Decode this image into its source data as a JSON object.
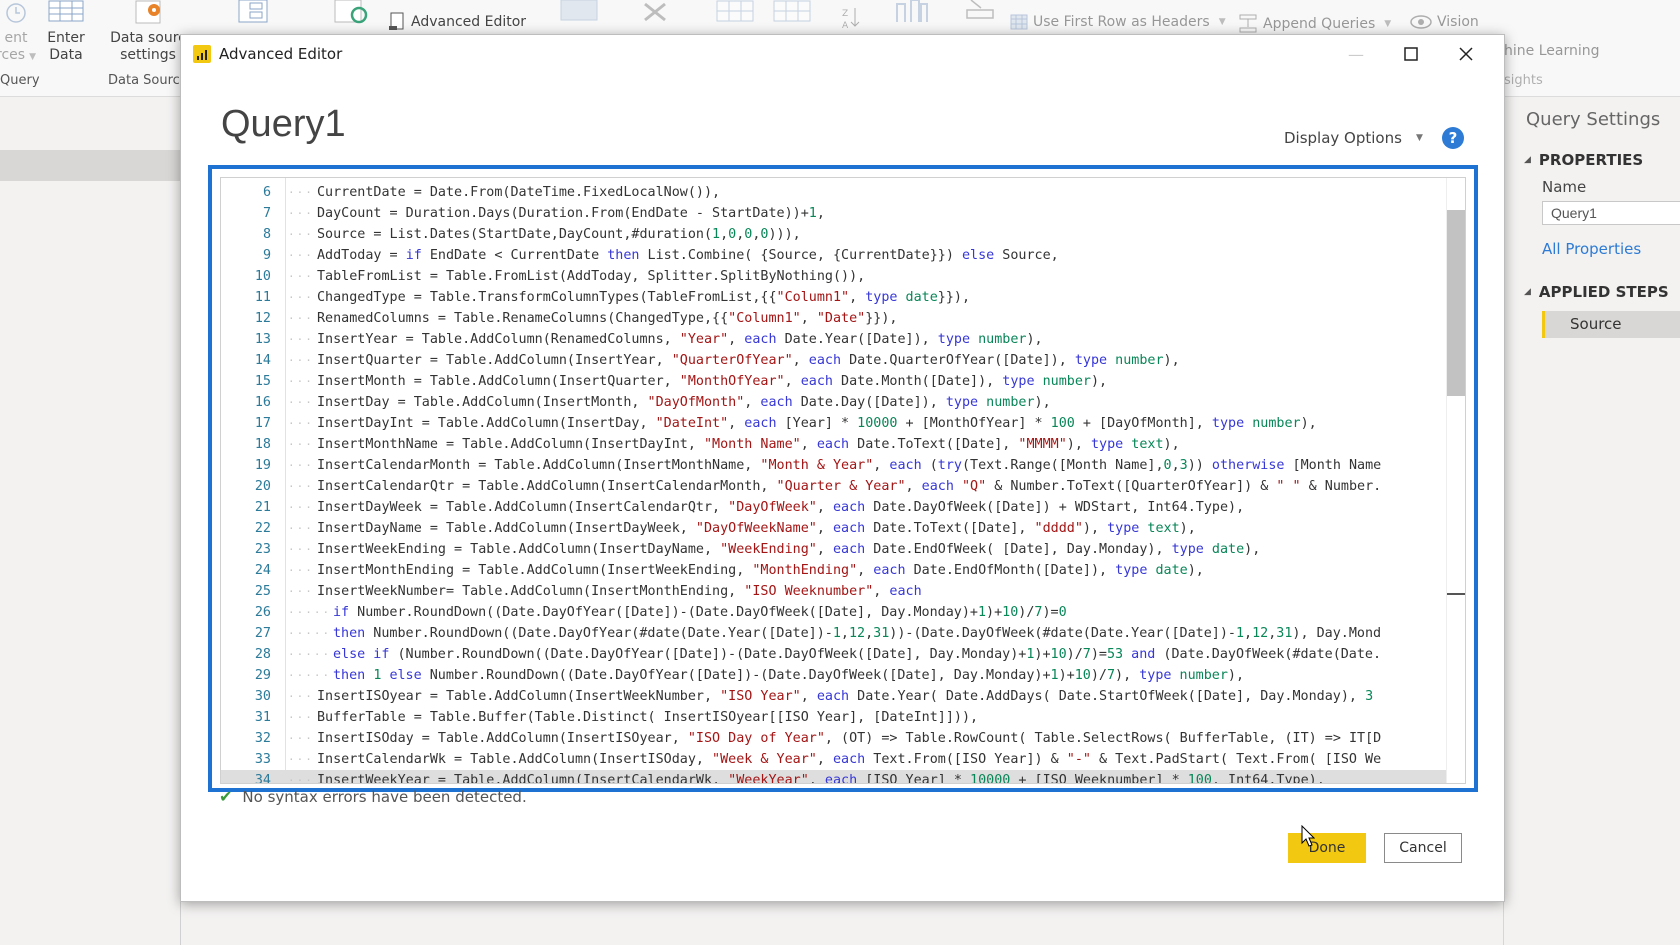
{
  "ribbon": {
    "recent_sources": "Recent Sources",
    "recent_sources_line1": "ent",
    "recent_sources_line2": "rces",
    "enter_data_line1": "Enter",
    "enter_data_line2": "Data",
    "data_source_settings_line1": "Data sourc",
    "data_source_settings_line2": "settings",
    "advanced_editor": "Advanced Editor",
    "use_first_row": "Use First Row as Headers",
    "append_queries": "Append Queries",
    "vision": "Vision",
    "machine_learning": "hine Learning",
    "insights": "sights",
    "group_query": "Query",
    "group_data_sources": "Data Sourc"
  },
  "query_settings": {
    "title": "Query Settings",
    "properties_header": "PROPERTIES",
    "name_label": "Name",
    "name_value": "Query1",
    "all_properties": "All Properties",
    "applied_steps_header": "APPLIED STEPS",
    "steps": [
      "Source"
    ]
  },
  "dialog": {
    "window_title": "Advanced Editor",
    "query_name": "Query1",
    "display_options": "Display Options",
    "help": "?",
    "status_message": "No syntax errors have been detected.",
    "done_label": "Done",
    "cancel_label": "Cancel"
  },
  "code_lines": [
    {
      "n": "6",
      "d": 1,
      "h": [
        [
          "",
          "CurrentDate = Date.From(DateTime.FixedLocalNow()),"
        ]
      ]
    },
    {
      "n": "7",
      "d": 1,
      "h": [
        [
          "",
          "DayCount = Duration.Days(Duration.From(EndDate - StartDate))+"
        ],
        [
          "n",
          "1"
        ],
        [
          "",
          ","
        ]
      ]
    },
    {
      "n": "8",
      "d": 1,
      "h": [
        [
          "",
          "Source = List.Dates(StartDate,DayCount,#duration("
        ],
        [
          "n",
          "1"
        ],
        [
          "",
          ","
        ],
        [
          "n",
          "0"
        ],
        [
          "",
          ","
        ],
        [
          "n",
          "0"
        ],
        [
          "",
          ","
        ],
        [
          "n",
          "0"
        ],
        [
          "",
          "))),"
        ]
      ]
    },
    {
      "n": "9",
      "d": 1,
      "h": [
        [
          "",
          "AddToday = "
        ],
        [
          "k",
          "if"
        ],
        [
          "",
          " EndDate < CurrentDate "
        ],
        [
          "k",
          "then"
        ],
        [
          "",
          " List.Combine( {Source, {CurrentDate}}) "
        ],
        [
          "k",
          "else"
        ],
        [
          "",
          " Source,"
        ]
      ]
    },
    {
      "n": "10",
      "d": 1,
      "h": [
        [
          "",
          "TableFromList = Table.FromList(AddToday, Splitter.SplitByNothing()),"
        ]
      ]
    },
    {
      "n": "11",
      "d": 1,
      "h": [
        [
          "",
          "ChangedType = Table.TransformColumnTypes(TableFromList,{{"
        ],
        [
          "s",
          "\"Column1\""
        ],
        [
          "",
          ", "
        ],
        [
          "k",
          "type"
        ],
        [
          "t",
          " date"
        ],
        [
          "",
          "}}),"
        ]
      ]
    },
    {
      "n": "12",
      "d": 1,
      "h": [
        [
          "",
          "RenamedColumns = Table.RenameColumns(ChangedType,{{"
        ],
        [
          "s",
          "\"Column1\""
        ],
        [
          "",
          ", "
        ],
        [
          "s",
          "\"Date\""
        ],
        [
          "",
          "}}),"
        ]
      ]
    },
    {
      "n": "13",
      "d": 1,
      "h": [
        [
          "",
          "InsertYear = Table.AddColumn(RenamedColumns, "
        ],
        [
          "s",
          "\"Year\""
        ],
        [
          "",
          ", "
        ],
        [
          "k",
          "each"
        ],
        [
          "",
          " Date.Year([Date]), "
        ],
        [
          "k",
          "type"
        ],
        [
          "t",
          " number"
        ],
        [
          "",
          "),"
        ]
      ]
    },
    {
      "n": "14",
      "d": 1,
      "h": [
        [
          "",
          "InsertQuarter = Table.AddColumn(InsertYear, "
        ],
        [
          "s",
          "\"QuarterOfYear\""
        ],
        [
          "",
          ", "
        ],
        [
          "k",
          "each"
        ],
        [
          "",
          " Date.QuarterOfYear([Date]), "
        ],
        [
          "k",
          "type"
        ],
        [
          "t",
          " number"
        ],
        [
          "",
          "),"
        ]
      ]
    },
    {
      "n": "15",
      "d": 1,
      "h": [
        [
          "",
          "InsertMonth = Table.AddColumn(InsertQuarter, "
        ],
        [
          "s",
          "\"MonthOfYear\""
        ],
        [
          "",
          ", "
        ],
        [
          "k",
          "each"
        ],
        [
          "",
          " Date.Month([Date]), "
        ],
        [
          "k",
          "type"
        ],
        [
          "t",
          " number"
        ],
        [
          "",
          "),"
        ]
      ]
    },
    {
      "n": "16",
      "d": 1,
      "h": [
        [
          "",
          "InsertDay = Table.AddColumn(InsertMonth, "
        ],
        [
          "s",
          "\"DayOfMonth\""
        ],
        [
          "",
          ", "
        ],
        [
          "k",
          "each"
        ],
        [
          "",
          " Date.Day([Date]), "
        ],
        [
          "k",
          "type"
        ],
        [
          "t",
          " number"
        ],
        [
          "",
          "),"
        ]
      ]
    },
    {
      "n": "17",
      "d": 1,
      "h": [
        [
          "",
          "InsertDayInt = Table.AddColumn(InsertDay, "
        ],
        [
          "s",
          "\"DateInt\""
        ],
        [
          "",
          ", "
        ],
        [
          "k",
          "each"
        ],
        [
          "",
          " [Year] * "
        ],
        [
          "n",
          "10000"
        ],
        [
          "",
          " + [MonthOfYear] * "
        ],
        [
          "n",
          "100"
        ],
        [
          "",
          " + [DayOfMonth], "
        ],
        [
          "k",
          "type"
        ],
        [
          "t",
          " number"
        ],
        [
          "",
          "),"
        ]
      ]
    },
    {
      "n": "18",
      "d": 1,
      "h": [
        [
          "",
          "InsertMonthName = Table.AddColumn(InsertDayInt, "
        ],
        [
          "s",
          "\"Month Name\""
        ],
        [
          "",
          ", "
        ],
        [
          "k",
          "each"
        ],
        [
          "",
          " Date.ToText([Date], "
        ],
        [
          "s",
          "\"MMMM\""
        ],
        [
          "",
          "), "
        ],
        [
          "k",
          "type"
        ],
        [
          "t",
          " text"
        ],
        [
          "",
          "),"
        ]
      ]
    },
    {
      "n": "19",
      "d": 1,
      "h": [
        [
          "",
          "InsertCalendarMonth = Table.AddColumn(InsertMonthName, "
        ],
        [
          "s",
          "\"Month & Year\""
        ],
        [
          "",
          ", "
        ],
        [
          "k",
          "each"
        ],
        [
          "",
          " ("
        ],
        [
          "k",
          "try"
        ],
        [
          "",
          "(Text.Range([Month Name],"
        ],
        [
          "n",
          "0"
        ],
        [
          "",
          ","
        ],
        [
          "n",
          "3"
        ],
        [
          "",
          ")) "
        ],
        [
          "k",
          "otherwise"
        ],
        [
          "",
          " [Month Name"
        ]
      ]
    },
    {
      "n": "20",
      "d": 1,
      "h": [
        [
          "",
          "InsertCalendarQtr = Table.AddColumn(InsertCalendarMonth, "
        ],
        [
          "s",
          "\"Quarter & Year\""
        ],
        [
          "",
          ", "
        ],
        [
          "k",
          "each"
        ],
        [
          "",
          " "
        ],
        [
          "s",
          "\"Q\""
        ],
        [
          "",
          " & Number.ToText([QuarterOfYear]) & "
        ],
        [
          "s",
          "\" \""
        ],
        [
          "",
          " & Number."
        ]
      ]
    },
    {
      "n": "21",
      "d": 1,
      "h": [
        [
          "",
          "InsertDayWeek = Table.AddColumn(InsertCalendarQtr, "
        ],
        [
          "s",
          "\"DayOfWeek\""
        ],
        [
          "",
          ", "
        ],
        [
          "k",
          "each"
        ],
        [
          "",
          " Date.DayOfWeek([Date]) + WDStart, Int64.Type),"
        ]
      ]
    },
    {
      "n": "22",
      "d": 1,
      "h": [
        [
          "",
          "InsertDayName = Table.AddColumn(InsertDayWeek, "
        ],
        [
          "s",
          "\"DayOfWeekName\""
        ],
        [
          "",
          ", "
        ],
        [
          "k",
          "each"
        ],
        [
          "",
          " Date.ToText([Date], "
        ],
        [
          "s",
          "\"dddd\""
        ],
        [
          "",
          "), "
        ],
        [
          "k",
          "type"
        ],
        [
          "t",
          " text"
        ],
        [
          "",
          "),"
        ]
      ]
    },
    {
      "n": "23",
      "d": 1,
      "h": [
        [
          "",
          "InsertWeekEnding = Table.AddColumn(InsertDayName, "
        ],
        [
          "s",
          "\"WeekEnding\""
        ],
        [
          "",
          ", "
        ],
        [
          "k",
          "each"
        ],
        [
          "",
          " Date.EndOfWeek( [Date], Day.Monday), "
        ],
        [
          "k",
          "type"
        ],
        [
          "t",
          " date"
        ],
        [
          "",
          "),"
        ]
      ]
    },
    {
      "n": "24",
      "d": 1,
      "h": [
        [
          "",
          "InsertMonthEnding = Table.AddColumn(InsertWeekEnding, "
        ],
        [
          "s",
          "\"MonthEnding\""
        ],
        [
          "",
          ", "
        ],
        [
          "k",
          "each"
        ],
        [
          "",
          " Date.EndOfMonth([Date]), "
        ],
        [
          "k",
          "type"
        ],
        [
          "t",
          " date"
        ],
        [
          "",
          "),"
        ]
      ]
    },
    {
      "n": "25",
      "d": 1,
      "h": [
        [
          "",
          "InsertWeekNumber= Table.AddColumn(InsertMonthEnding, "
        ],
        [
          "s",
          "\"ISO Weeknumber\""
        ],
        [
          "",
          ", "
        ],
        [
          "k",
          "each"
        ]
      ]
    },
    {
      "n": "26",
      "d": 2,
      "h": [
        [
          "k",
          "if"
        ],
        [
          "",
          " Number.RoundDown((Date.DayOfYear([Date])-(Date.DayOfWeek([Date], Day.Monday)+"
        ],
        [
          "n",
          "1"
        ],
        [
          "",
          ")+"
        ],
        [
          "n",
          "10"
        ],
        [
          "",
          ")/"
        ],
        [
          "n",
          "7"
        ],
        [
          "",
          ")="
        ],
        [
          "n",
          "0"
        ]
      ]
    },
    {
      "n": "27",
      "d": 2,
      "h": [
        [
          "k",
          "then"
        ],
        [
          "",
          " Number.RoundDown((Date.DayOfYear(#date(Date.Year([Date])-"
        ],
        [
          "n",
          "1"
        ],
        [
          "",
          ","
        ],
        [
          "n",
          "12"
        ],
        [
          "",
          ","
        ],
        [
          "n",
          "31"
        ],
        [
          "",
          "))-(Date.DayOfWeek(#date(Date.Year([Date])-"
        ],
        [
          "n",
          "1"
        ],
        [
          "",
          ","
        ],
        [
          "n",
          "12"
        ],
        [
          "",
          ","
        ],
        [
          "n",
          "31"
        ],
        [
          "",
          "), Day.Mond"
        ]
      ]
    },
    {
      "n": "28",
      "d": 2,
      "h": [
        [
          "k",
          "else if"
        ],
        [
          "",
          " (Number.RoundDown((Date.DayOfYear([Date])-(Date.DayOfWeek([Date], Day.Monday)+"
        ],
        [
          "n",
          "1"
        ],
        [
          "",
          ")+"
        ],
        [
          "n",
          "10"
        ],
        [
          "",
          ")/"
        ],
        [
          "n",
          "7"
        ],
        [
          "",
          ")="
        ],
        [
          "n",
          "53"
        ],
        [
          "",
          " "
        ],
        [
          "k",
          "and"
        ],
        [
          "",
          " (Date.DayOfWeek(#date(Date."
        ]
      ]
    },
    {
      "n": "29",
      "d": 2,
      "h": [
        [
          "k",
          "then"
        ],
        [
          "",
          " "
        ],
        [
          "n",
          "1"
        ],
        [
          "",
          " "
        ],
        [
          "k",
          "else"
        ],
        [
          "",
          " Number.RoundDown((Date.DayOfYear([Date])-(Date.DayOfWeek([Date], Day.Monday)+"
        ],
        [
          "n",
          "1"
        ],
        [
          "",
          ")+"
        ],
        [
          "n",
          "10"
        ],
        [
          "",
          ")/"
        ],
        [
          "n",
          "7"
        ],
        [
          "",
          "), "
        ],
        [
          "k",
          "type"
        ],
        [
          "t",
          " number"
        ],
        [
          "",
          "),"
        ]
      ]
    },
    {
      "n": "30",
      "d": 1,
      "h": [
        [
          "",
          "InsertISOyear = Table.AddColumn(InsertWeekNumber, "
        ],
        [
          "s",
          "\"ISO Year\""
        ],
        [
          "",
          ", "
        ],
        [
          "k",
          "each"
        ],
        [
          "",
          " Date.Year( Date.AddDays( Date.StartOfWeek([Date], Day.Monday), "
        ],
        [
          "n",
          "3"
        ]
      ]
    },
    {
      "n": "31",
      "d": 1,
      "h": [
        [
          "",
          "BufferTable = Table.Buffer(Table.Distinct( InsertISOyear[[ISO Year], [DateInt]])),"
        ]
      ]
    },
    {
      "n": "32",
      "d": 1,
      "h": [
        [
          "",
          "InsertISOday = Table.AddColumn(InsertISOyear, "
        ],
        [
          "s",
          "\"ISO Day of Year\""
        ],
        [
          "",
          ", (OT) => Table.RowCount( Table.SelectRows( BufferTable, (IT) => IT[D"
        ]
      ]
    },
    {
      "n": "33",
      "d": 1,
      "h": [
        [
          "",
          "InsertCalendarWk = Table.AddColumn(InsertISOday, "
        ],
        [
          "s",
          "\"Week & Year\""
        ],
        [
          "",
          ", "
        ],
        [
          "k",
          "each"
        ],
        [
          "",
          " Text.From([ISO Year]) & "
        ],
        [
          "s",
          "\"-\""
        ],
        [
          "",
          " & Text.PadStart( Text.From( [ISO We"
        ]
      ]
    },
    {
      "n": "34",
      "d": 1,
      "cur": true,
      "h": [
        [
          "",
          "InsertWeekYear = Table.AddColumn(InsertCalendarWk, "
        ],
        [
          "s",
          "\"WeekYear\""
        ],
        [
          "",
          ", "
        ],
        [
          "k",
          "each"
        ],
        [
          "",
          " [ISO Year] * "
        ],
        [
          "n",
          "10000"
        ],
        [
          "",
          " + [ISO Weeknumber] * "
        ],
        [
          "n",
          "100"
        ],
        [
          "",
          ", Int64.Type),"
        ]
      ]
    }
  ]
}
